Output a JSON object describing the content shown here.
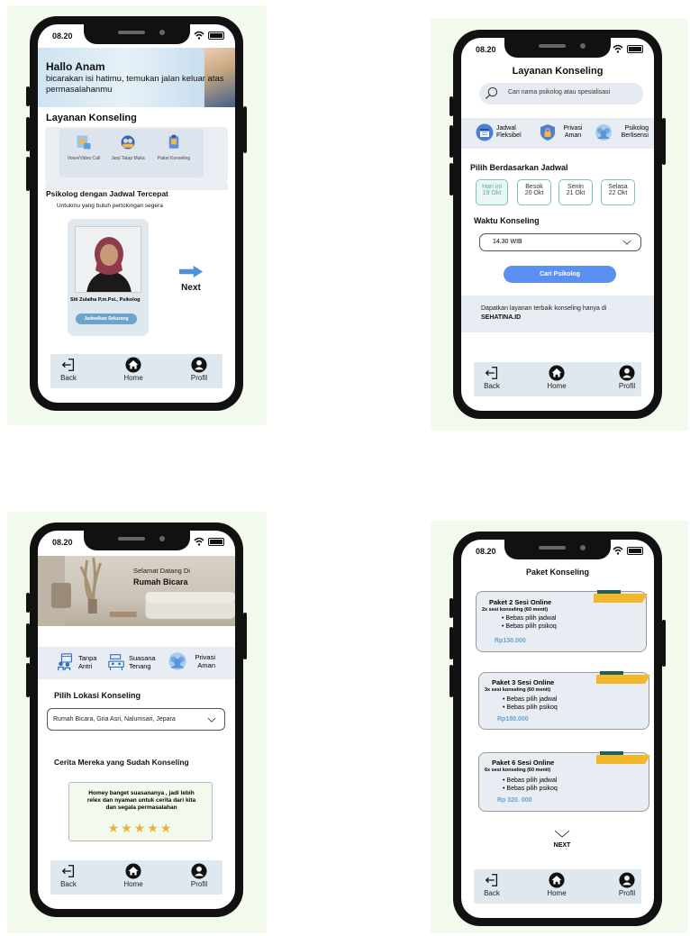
{
  "nav": {
    "back": "Back",
    "home": "Home",
    "profile": "Profil"
  },
  "status": {
    "time": "08.20"
  },
  "screen1": {
    "greeting": "Hallo Anam",
    "tagline": "bicarakan isi hatimu, temukan jalan keluar atas permasalahanmu",
    "section_title": "Layanan Konseling",
    "services": [
      {
        "label": "Voice/Video Call",
        "icon": "video-call-icon"
      },
      {
        "label": "Janji Tatap Muka",
        "icon": "meeting-icon"
      },
      {
        "label": "Paket Konseling",
        "icon": "package-icon"
      }
    ],
    "psych_heading": "Psikolog dengan Jadwal Tercepat",
    "psych_sub": "Untukmu yang butuh pertolongan segera",
    "psych_name": "Siti Zulaiha P,m.Psi., Psikolog",
    "schedule_button": "Jadwalkan Sekarang",
    "next_label": "Next"
  },
  "screen2": {
    "title": "Layanan Konseling",
    "search_placeholder": "Cari nama psikolog atau spesialisasi",
    "features": [
      {
        "label": "Jadwal Fleksibel",
        "icon": "calendar-icon"
      },
      {
        "label": "Privasi Aman",
        "icon": "lock-shield-icon"
      },
      {
        "label": "Psikolog Berlisensi",
        "icon": "people-icon"
      }
    ],
    "schedule_heading": "Pilih Berdasarkan Jadwal",
    "days": [
      {
        "day": "Hari ini",
        "date": "19 Okt",
        "selected": true
      },
      {
        "day": "Besok",
        "date": "20 Okt",
        "selected": false
      },
      {
        "day": "Senin",
        "date": "21 Okt",
        "selected": false
      },
      {
        "day": "Selasa",
        "date": "22 Okt",
        "selected": false
      }
    ],
    "time_heading": "Waktu  Konseling",
    "time_value": "14.30 WIB",
    "search_button": "Cari Psikolog",
    "promo_text": "Dapatkan layanan terbaik konseling hanya di",
    "promo_brand": "SEHATINA.ID"
  },
  "screen3": {
    "welcome": "Selamat Datang Di",
    "venue": "Rumah Bicara",
    "features": [
      {
        "label": "Tanpa Antri",
        "icon": "queue-icon"
      },
      {
        "label": "Suasana Tenang",
        "icon": "calm-room-icon"
      },
      {
        "label": "Privasi Aman",
        "icon": "people-icon"
      }
    ],
    "location_heading": "Pilih Lokasi Konseling",
    "location_value": "Rumah Bicara, Gria Asri, Nalumsari, Jepara",
    "stories_heading": "Cerita Mereka yang Sudah Konseling",
    "testimonial": "Homey banget suasananya , jadi lebih relex dan nyaman untuk cerita dari kita dan segala permasalahan",
    "rating": 5
  },
  "screen4": {
    "title": "Paket Konseling",
    "packages": [
      {
        "name": "Paket 2 Sesi Online",
        "detail": "2x sesi konseling (60  menit)",
        "bullets": [
          "Bebas pilih jadwal",
          "Bebas pilih psikoq"
        ],
        "price": "Rp130.000"
      },
      {
        "name": "Paket 3 Sesi Online",
        "detail": "3x sesi konseling (60  menit)",
        "bullets": [
          "Bebas pilih jadwal",
          "Bebas pilih psikoq"
        ],
        "price": "Rp180.000"
      },
      {
        "name": "Paket 6 Sesi Online",
        "detail": "6x sesi konseling (60  menit)",
        "bullets": [
          "Bebas pilih jadwal",
          "Bebas pilih psikoq"
        ],
        "price": "Rp 320. 000"
      }
    ],
    "next_label": "NEXT"
  }
}
